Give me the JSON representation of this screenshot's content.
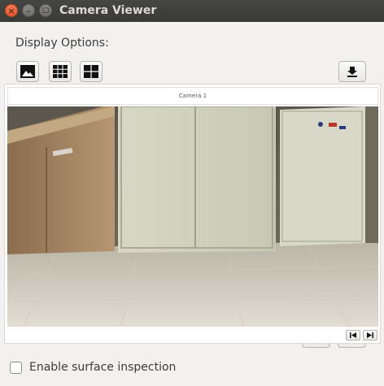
{
  "window": {
    "title": "Camera Viewer",
    "close_glyph": "×",
    "minimize_glyph": "–",
    "maximize_glyph": "□"
  },
  "display_options": {
    "label": "Display Options:",
    "buttons": [
      {
        "name": "single-view",
        "icon": "image-icon"
      },
      {
        "name": "grid-6-view",
        "icon": "grid-6-icon"
      },
      {
        "name": "grid-4-view",
        "icon": "grid-4-icon"
      }
    ],
    "download_icon": "download-icon"
  },
  "camera": {
    "header": "Camera 1",
    "prev_icon": "skip-back-icon",
    "next_icon": "skip-forward-icon"
  },
  "surface_inspection": {
    "label": "Enable surface inspection",
    "checked": false
  }
}
